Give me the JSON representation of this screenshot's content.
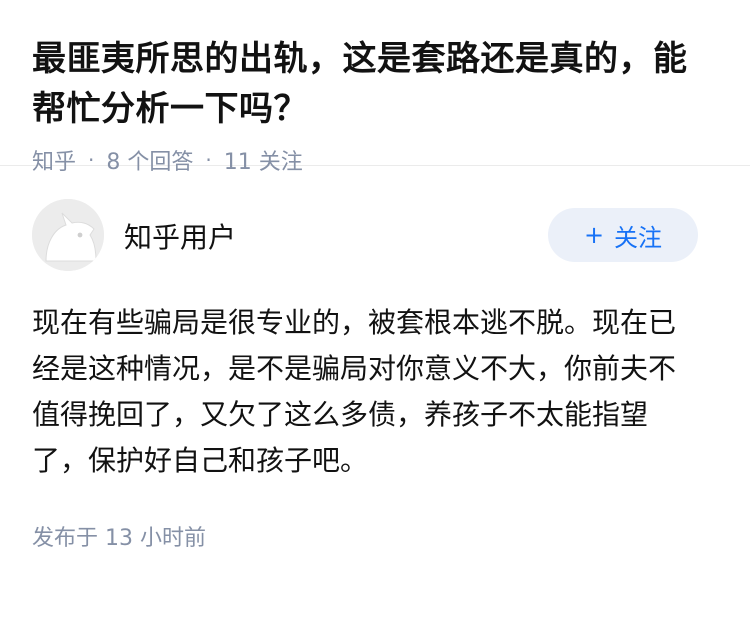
{
  "question": {
    "title": "最匪夷所思的出轨，这是套路还是真的，能帮忙分析一下吗？",
    "source": "知乎",
    "answers": "8 个回答",
    "followers": "11 关注",
    "separator": "·"
  },
  "answer": {
    "author": "知乎用户",
    "follow_plus": "+",
    "follow_label": "关注",
    "content": "现在有些骗局是很专业的，被套根本逃不脱。现在已经是这种情况，是不是骗局对你意义不大，你前夫不值得挽回了，又欠了这么多债，养孩子不太能指望了，保护好自己和孩子吧。",
    "published": "发布于  13 小时前"
  },
  "icons": {
    "avatar": "default-avatar-icon"
  },
  "colors": {
    "accent": "#1772f6",
    "follow_bg": "#ebf0f9",
    "meta": "#8590a6",
    "text": "#121212"
  }
}
